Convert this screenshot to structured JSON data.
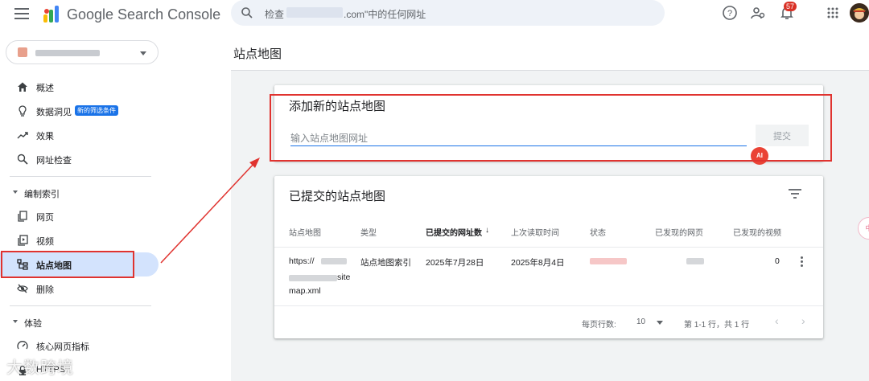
{
  "app": {
    "title": "Google Search Console"
  },
  "search": {
    "prefix": "检查",
    "suffix": ".com\"中的任何网址"
  },
  "header": {
    "notification_count": "57"
  },
  "sidebar": {
    "items": [
      {
        "label": "概述",
        "icon": "home-icon"
      },
      {
        "label": "数据洞见",
        "icon": "lightbulb-icon",
        "chip": "新的筛选条件"
      },
      {
        "label": "效果",
        "icon": "trending-up-icon"
      },
      {
        "label": "网址检查",
        "icon": "search-icon"
      }
    ],
    "section_index": {
      "label": "编制索引"
    },
    "index_items": [
      {
        "label": "网页",
        "icon": "pages-icon"
      },
      {
        "label": "视频",
        "icon": "video-page-icon"
      },
      {
        "label": "站点地图",
        "icon": "sitemap-icon",
        "active": true
      },
      {
        "label": "删除",
        "icon": "visibility-off-icon"
      }
    ],
    "section_experience": {
      "label": "体验"
    },
    "experience_items": [
      {
        "label": "核心网页指标",
        "icon": "speed-icon"
      },
      {
        "label": "HTTPS",
        "icon": "lock-icon"
      }
    ]
  },
  "watermark": "大数跨境",
  "page": {
    "title": "站点地图"
  },
  "add_card": {
    "title": "添加新的站点地图",
    "input_placeholder": "输入站点地图网址",
    "submit_label": "提交",
    "ai_badge": "AI"
  },
  "submitted_card": {
    "title": "已提交的站点地图",
    "columns": [
      "站点地图",
      "类型",
      "已提交的网址数",
      "上次读取时间",
      "状态",
      "已发现的网页",
      "已发现的视频"
    ],
    "sort_arrow": "↓",
    "rows": [
      {
        "sitemap_line1": "https://",
        "sitemap_line2": "site",
        "sitemap_line3": "map.xml",
        "type": "站点地图索引",
        "submitted": "2025年7月28日",
        "last_read": "2025年8月4日",
        "videos": "0"
      }
    ],
    "pager": {
      "rows_per_page_label": "每页行数:",
      "rows_per_page": "10",
      "range": "第 1-1 行，共 1 行",
      "prev": "‹",
      "next": "›"
    }
  },
  "side_float": "中",
  "colors": {
    "accent": "#1a73e8",
    "highlight": "#e0332f",
    "active_bg": "#d3e3fd"
  }
}
